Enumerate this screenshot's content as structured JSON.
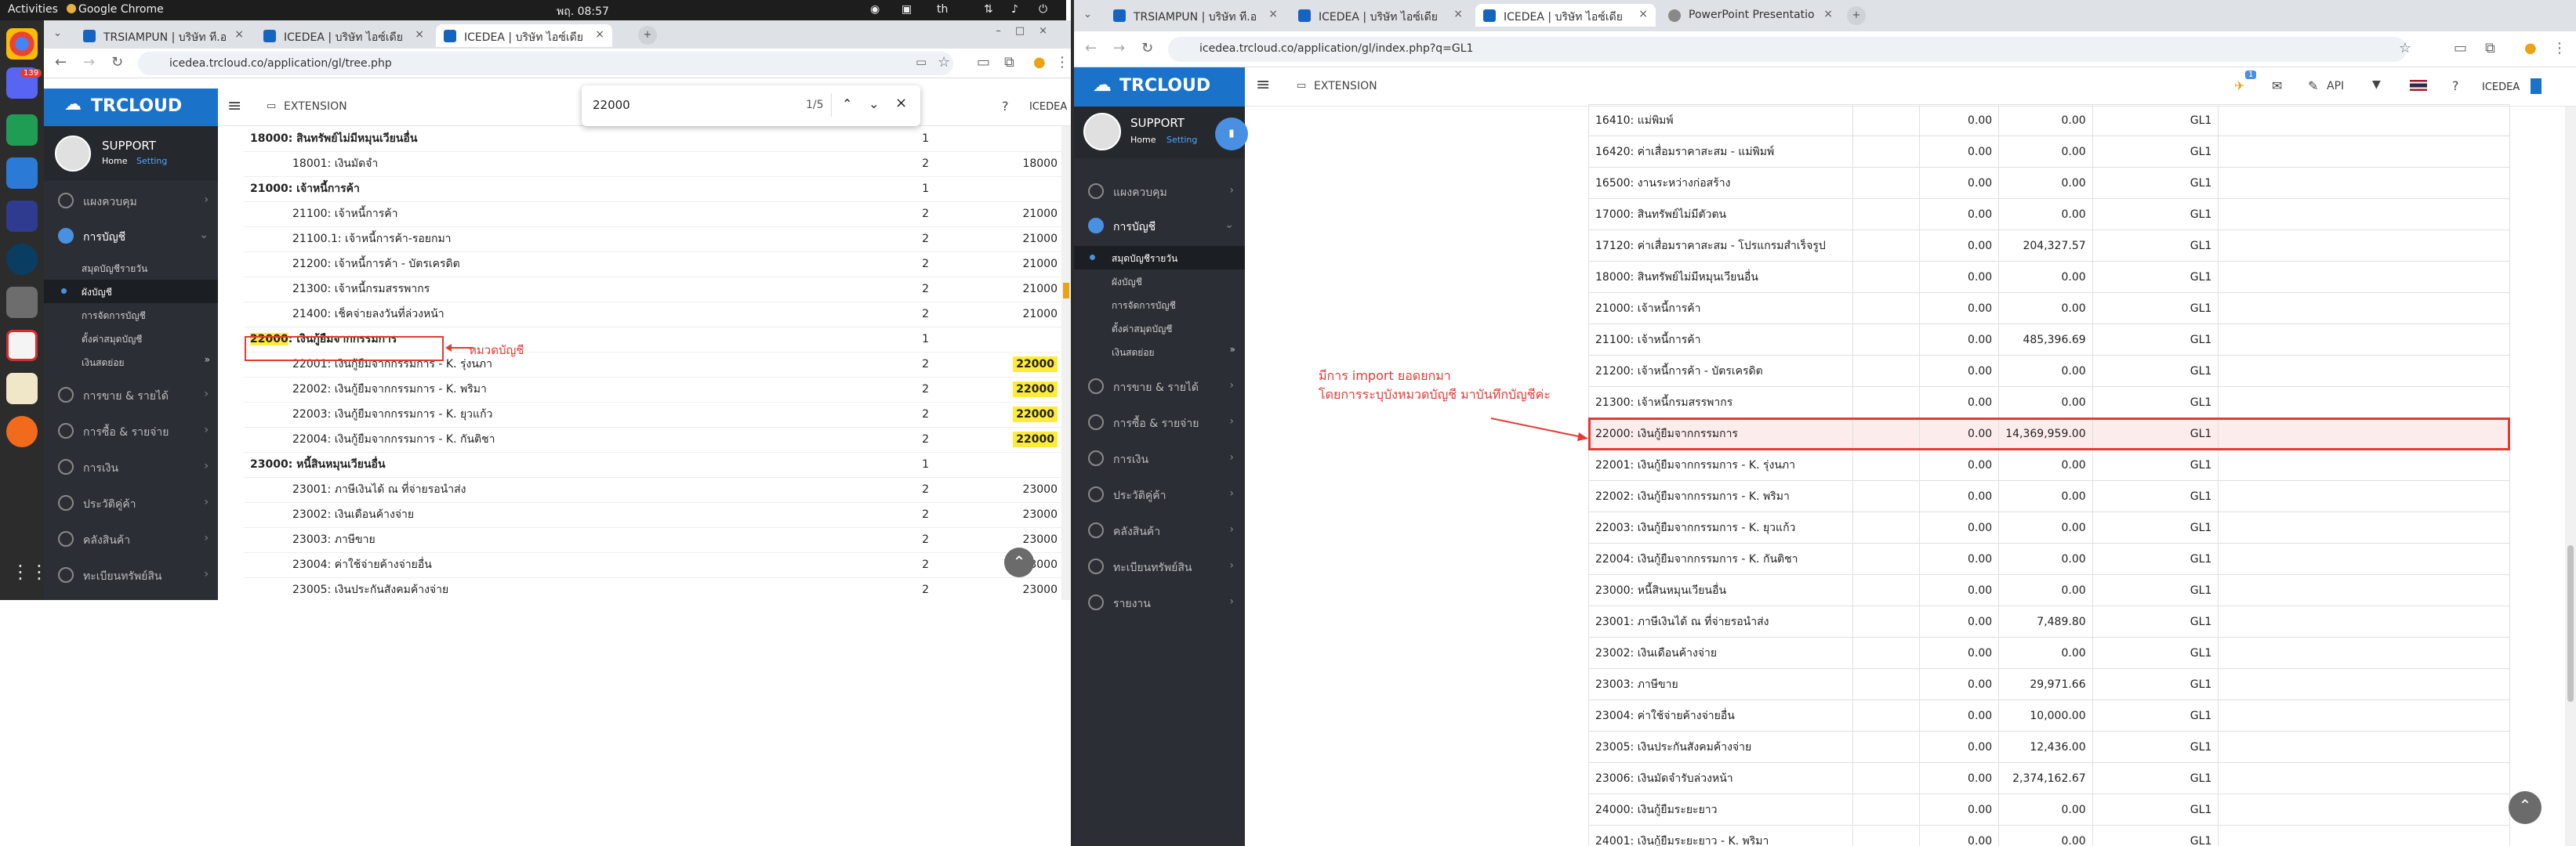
{
  "gnome": {
    "activities": "Activities",
    "app": "Google Chrome",
    "clock": "พฤ. 08:57",
    "lang": "th"
  },
  "dock_badge": "139",
  "left": {
    "tabs": [
      {
        "label": "TRSIAMPUN | บริษัท ที.อ"
      },
      {
        "label": "ICEDEA | บริษัท ไอซ์เดีย"
      },
      {
        "label": "ICEDEA | บริษัท ไอซ์เดีย"
      }
    ],
    "url": "icedea.trcloud.co/application/gl/tree.php",
    "find": {
      "query": "22000",
      "count": "1/5"
    },
    "brand": "TRCLOUD",
    "extension": "EXTENSION",
    "company": "ICEDEA",
    "profile": {
      "name": "SUPPORT",
      "home": "Home",
      "setting": "Setting"
    },
    "menu": [
      "แผงควบคุม",
      "การบัญชี"
    ],
    "submenu": [
      "สมุดบัญชีรายวัน",
      "ผังบัญชี",
      "การจัดการบัญชี",
      "ตั้งค่าสมุดบัญชี",
      "เงินสดย่อย"
    ],
    "menu2": [
      "การขาย & รายได้",
      "การซื้อ & รายจ่าย",
      "การเงิน",
      "ประวัติคู่ค้า",
      "คลังสินค้า",
      "ทะเบียนทรัพย์สิน"
    ],
    "annotation": "หมวดบัญชี",
    "rows": [
      {
        "name": "18000: สินทรัพย์ไม่มีหมุนเวียนอื่น",
        "lvl": "1",
        "parent": "",
        "bold": true,
        "indent": false
      },
      {
        "name": "18001: เงินมัดจำ",
        "lvl": "2",
        "parent": "18000",
        "bold": false,
        "indent": true
      },
      {
        "name": "21000: เจ้าหนี้การค้า",
        "lvl": "1",
        "parent": "",
        "bold": true,
        "indent": false
      },
      {
        "name": "21100: เจ้าหนี้การค้า",
        "lvl": "2",
        "parent": "21000",
        "bold": false,
        "indent": true
      },
      {
        "name": "21100.1: เจ้าหนี้การค้า-รอยกมา",
        "lvl": "2",
        "parent": "21000",
        "bold": false,
        "indent": true
      },
      {
        "name": "21200: เจ้าหนี้การค้า - บัตรเครดิต",
        "lvl": "2",
        "parent": "21000",
        "bold": false,
        "indent": true
      },
      {
        "name": "21300: เจ้าหนี้กรมสรรพากร",
        "lvl": "2",
        "parent": "21000",
        "bold": false,
        "indent": true
      },
      {
        "name": "21400: เช็คจ่ายลงวันที่ล่วงหน้า",
        "lvl": "2",
        "parent": "21000",
        "bold": false,
        "indent": true
      },
      {
        "code": "22000",
        "name": ": เงินกู้ยืมจากกรรมการ",
        "lvl": "1",
        "parent": "",
        "bold": true,
        "indent": false,
        "boxed": true
      },
      {
        "name": "22001: เงินกู้ยืมจากกรรมการ - K. รุ่งนภา",
        "lvl": "2",
        "parent": "22000",
        "bold": false,
        "indent": true,
        "hlp": true
      },
      {
        "name": "22002: เงินกู้ยืมจากกรรมการ - K. พริมา",
        "lvl": "2",
        "parent": "22000",
        "bold": false,
        "indent": true,
        "hlp": true
      },
      {
        "name": "22003: เงินกู้ยืมจากกรรมการ - K. ยุวแก้ว",
        "lvl": "2",
        "parent": "22000",
        "bold": false,
        "indent": true,
        "hlp": true
      },
      {
        "name": "22004: เงินกู้ยืมจากกรรมการ - K. กันติชา",
        "lvl": "2",
        "parent": "22000",
        "bold": false,
        "indent": true,
        "hlp": true
      },
      {
        "name": "23000: หนี้สินหมุนเวียนอื่น",
        "lvl": "1",
        "parent": "",
        "bold": true,
        "indent": false
      },
      {
        "name": "23001: ภาษีเงินได้ ณ ที่จ่ายรอนำส่ง",
        "lvl": "2",
        "parent": "23000",
        "bold": false,
        "indent": true
      },
      {
        "name": "23002: เงินเดือนค้างจ่าย",
        "lvl": "2",
        "parent": "23000",
        "bold": false,
        "indent": true
      },
      {
        "name": "23003: ภาษีขาย",
        "lvl": "2",
        "parent": "23000",
        "bold": false,
        "indent": true
      },
      {
        "name": "23004: ค่าใช้จ่ายค้างจ่ายอื่น",
        "lvl": "2",
        "parent": "23000",
        "bold": false,
        "indent": true
      },
      {
        "name": "23005: เงินประกันสังคมค้างจ่าย",
        "lvl": "2",
        "parent": "23000",
        "bold": false,
        "indent": true
      }
    ]
  },
  "right": {
    "tabs": [
      {
        "label": "TRSIAMPUN | บริษัท ที.อ"
      },
      {
        "label": "ICEDEA | บริษัท ไอซ์เดีย"
      },
      {
        "label": "ICEDEA | บริษัท ไอซ์เดีย"
      },
      {
        "label": "PowerPoint Presentatio"
      }
    ],
    "url": "icedea.trcloud.co/application/gl/index.php?q=GL1",
    "brand": "TRCLOUD",
    "extension": "EXTENSION",
    "api": "API",
    "company": "ICEDEA",
    "notif": "1",
    "profile": {
      "name": "SUPPORT",
      "home": "Home",
      "setting": "Setting"
    },
    "menu": [
      "แผงควบคุม",
      "การบัญชี"
    ],
    "submenu": [
      "สมุดบัญชีรายวัน",
      "ผังบัญชี",
      "การจัดการบัญชี",
      "ตั้งค่าสมุดบัญชี",
      "เงินสดย่อย"
    ],
    "menu2": [
      "การขาย & รายได้",
      "การซื้อ & รายจ่าย",
      "การเงิน",
      "ประวัติคู่ค้า",
      "คลังสินค้า",
      "ทะเบียนทรัพย์สิน",
      "รายงาน"
    ],
    "annotation": [
      "มีการ import ยอดยกมา",
      "โดยการระบุบังหมวดบัญชี มาบันทึกบัญชีค่ะ"
    ],
    "rows": [
      {
        "name": "16410: แม่พิมพ์",
        "dr": "0.00",
        "cr": "0.00",
        "book": "GL1"
      },
      {
        "name": "16420: ค่าเสื่อมราคาสะสม - แม่พิมพ์",
        "dr": "0.00",
        "cr": "0.00",
        "book": "GL1"
      },
      {
        "name": "16500: งานระหว่างก่อสร้าง",
        "dr": "0.00",
        "cr": "0.00",
        "book": "GL1"
      },
      {
        "name": "17000: สินทรัพย์ไม่มีตัวตน",
        "dr": "0.00",
        "cr": "0.00",
        "book": "GL1"
      },
      {
        "name": "17120: ค่าเสื่อมราคาสะสม - โปรแกรมสำเร็จรูป",
        "dr": "0.00",
        "cr": "204,327.57",
        "book": "GL1"
      },
      {
        "name": "18000: สินทรัพย์ไม่มีหมุนเวียนอื่น",
        "dr": "0.00",
        "cr": "0.00",
        "book": "GL1"
      },
      {
        "name": "21000: เจ้าหนี้การค้า",
        "dr": "0.00",
        "cr": "0.00",
        "book": "GL1"
      },
      {
        "name": "21100: เจ้าหนี้การค้า",
        "dr": "0.00",
        "cr": "485,396.69",
        "book": "GL1"
      },
      {
        "name": "21200: เจ้าหนี้การค้า - บัตรเครดิต",
        "dr": "0.00",
        "cr": "0.00",
        "book": "GL1"
      },
      {
        "name": "21300: เจ้าหนี้กรมสรรพากร",
        "dr": "0.00",
        "cr": "0.00",
        "book": "GL1"
      },
      {
        "name": "22000: เงินกู้ยืมจากกรรมการ",
        "dr": "0.00",
        "cr": "14,369,959.00",
        "book": "GL1",
        "boxed": true
      },
      {
        "name": "22001: เงินกู้ยืมจากกรรมการ - K. รุ่งนภา",
        "dr": "0.00",
        "cr": "0.00",
        "book": "GL1"
      },
      {
        "name": "22002: เงินกู้ยืมจากกรรมการ - K. พริมา",
        "dr": "0.00",
        "cr": "0.00",
        "book": "GL1"
      },
      {
        "name": "22003: เงินกู้ยืมจากกรรมการ - K. ยุวแก้ว",
        "dr": "0.00",
        "cr": "0.00",
        "book": "GL1"
      },
      {
        "name": "22004: เงินกู้ยืมจากกรรมการ - K. กันติชา",
        "dr": "0.00",
        "cr": "0.00",
        "book": "GL1"
      },
      {
        "name": "23000: หนี้สินหมุนเวียนอื่น",
        "dr": "0.00",
        "cr": "0.00",
        "book": "GL1"
      },
      {
        "name": "23001: ภาษีเงินได้ ณ ที่จ่ายรอนำส่ง",
        "dr": "0.00",
        "cr": "7,489.80",
        "book": "GL1"
      },
      {
        "name": "23002: เงินเดือนค้างจ่าย",
        "dr": "0.00",
        "cr": "0.00",
        "book": "GL1"
      },
      {
        "name": "23003: ภาษีขาย",
        "dr": "0.00",
        "cr": "29,971.66",
        "book": "GL1"
      },
      {
        "name": "23004: ค่าใช้จ่ายค้างจ่ายอื่น",
        "dr": "0.00",
        "cr": "10,000.00",
        "book": "GL1"
      },
      {
        "name": "23005: เงินประกันสังคมค้างจ่าย",
        "dr": "0.00",
        "cr": "12,436.00",
        "book": "GL1"
      },
      {
        "name": "23006: เงินมัดจำรับล่วงหน้า",
        "dr": "0.00",
        "cr": "2,374,162.67",
        "book": "GL1"
      },
      {
        "name": "24000: เงินกู้ยืมระยะยาว",
        "dr": "0.00",
        "cr": "0.00",
        "book": "GL1"
      },
      {
        "name": "24001: เงินกู้ยืมระยะยาว - K. พริมา",
        "dr": "0.00",
        "cr": "0.00",
        "book": "GL1"
      }
    ]
  },
  "colors": {
    "brand": "#1a73c8",
    "sidebar": "#2b2f35",
    "highlight": "#ffeb3b",
    "annotation": "#e53935"
  }
}
